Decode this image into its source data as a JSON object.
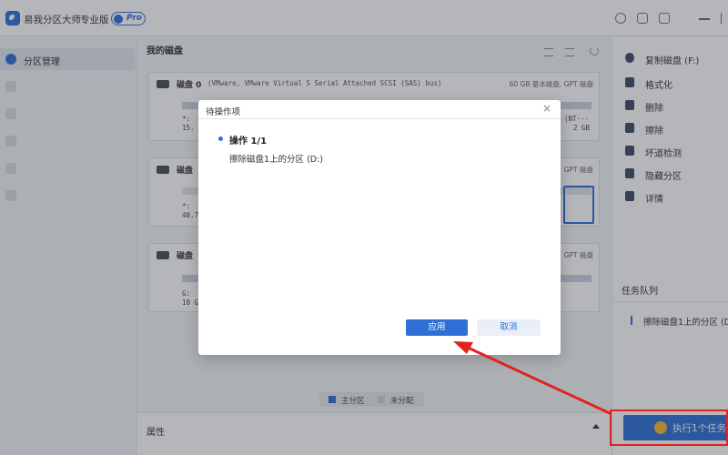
{
  "app": {
    "title": "易我分区大师",
    "edition": "专业版",
    "badge": "Pro"
  },
  "sidebar": {
    "items": [
      {
        "label": "分区管理",
        "active": true
      },
      {
        "label": ""
      },
      {
        "label": ""
      },
      {
        "label": ""
      },
      {
        "label": ""
      },
      {
        "label": ""
      }
    ]
  },
  "main": {
    "title": "我的磁盘",
    "disks": [
      {
        "name": "磁盘 0",
        "desc": "(VMware,  VMware Virtual S Serial Attached SCSI (SAS) bus)",
        "info": "60 GB 基本磁盘, GPT 磁盘",
        "part_text_1": "*: ",
        "part_text_2": "15.",
        "right_text_1": "(NT···",
        "right_text_2": "2 GB"
      },
      {
        "name": "磁盘",
        "info": "GPT 磁盘",
        "part_text_1": "*: ",
        "part_text_2": "40.7"
      },
      {
        "name": "磁盘",
        "info": "GPT 磁盘",
        "part_text_1": "G: ",
        "part_text_2": "10 G"
      }
    ],
    "legend": {
      "primary": "主分区",
      "unallocated": "未分配"
    },
    "properties": "属性"
  },
  "actions": [
    "复制磁盘 (F:)",
    "格式化",
    "删除",
    "擦除",
    "坏道检测",
    "隐藏分区",
    "详情"
  ],
  "queue": {
    "title": "任务队列",
    "item": "擦除磁盘1上的分区 (D"
  },
  "execute": {
    "label": "执行1个任务"
  },
  "modal": {
    "title": "待操作项",
    "operation_title": "操作 1/1",
    "operation_desc": "擦除磁盘1上的分区 (D:)",
    "apply": "应用",
    "cancel": "取消",
    "close": "×"
  },
  "colors": {
    "accent": "#2f6fd6",
    "highlight": "#e0231d"
  }
}
